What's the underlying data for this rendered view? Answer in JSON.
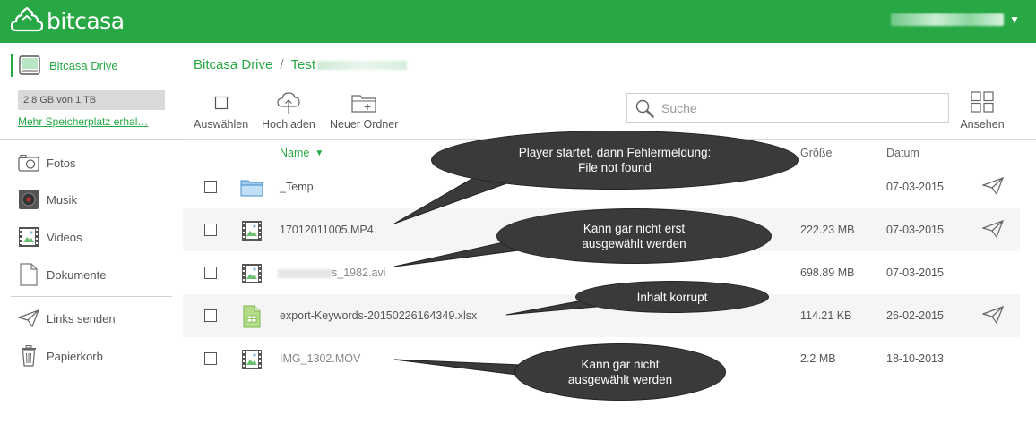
{
  "header": {
    "app_name": "bitcasa"
  },
  "sidebar": {
    "drive_label": "Bitcasa Drive",
    "storage_text": "2.8 GB von 1 TB",
    "storage_fraction": 0.0028,
    "more_storage_link": "Mehr Speicherplatz erhal…",
    "items": [
      {
        "label": "Fotos",
        "icon": "camera-icon"
      },
      {
        "label": "Musik",
        "icon": "music-disc-icon"
      },
      {
        "label": "Videos",
        "icon": "film-icon"
      },
      {
        "label": "Dokumente",
        "icon": "document-icon"
      },
      {
        "label": "Links senden",
        "icon": "paper-plane-icon"
      },
      {
        "label": "Papierkorb",
        "icon": "trash-icon"
      }
    ]
  },
  "breadcrumb": {
    "root": "Bitcasa Drive",
    "separator": "/",
    "current_visible": "Test"
  },
  "toolbar": {
    "select_label": "Auswählen",
    "upload_label": "Hochladen",
    "new_folder_label": "Neuer Ordner",
    "view_label": "Ansehen"
  },
  "search": {
    "placeholder": "Suche"
  },
  "table": {
    "col_name": "Name",
    "col_size": "Größe",
    "col_date": "Datum",
    "rows": [
      {
        "name": "_Temp",
        "size": "",
        "date": "07-03-2015",
        "type": "folder",
        "sendable": true
      },
      {
        "name": "17012011005.MP4",
        "size": "222.23 MB",
        "date": "07-03-2015",
        "type": "video",
        "sendable": true
      },
      {
        "name": "s_1982.avi",
        "size": "698.89 MB",
        "date": "07-03-2015",
        "type": "video",
        "sendable": false
      },
      {
        "name": "export-Keywords-20150226164349.xlsx",
        "size": "114.21 KB",
        "date": "26-02-2015",
        "type": "spreadsheet",
        "sendable": true
      },
      {
        "name": "IMG_1302.MOV",
        "size": "2.2 MB",
        "date": "18-10-2013",
        "type": "video",
        "sendable": false
      }
    ]
  },
  "callouts": [
    {
      "line1": "Player startet, dann Fehlermeldung:",
      "line2": "File not found"
    },
    {
      "line1": "Kann gar nicht erst",
      "line2": "ausgewählt werden"
    },
    {
      "line1": "Inhalt korrupt",
      "line2": ""
    },
    {
      "line1": "Kann gar nicht",
      "line2": "ausgewählt werden"
    }
  ],
  "colors": {
    "brand_green": "#27a844",
    "callout_bg": "#3a3a3a",
    "row_alt": "#f5f5f5"
  }
}
